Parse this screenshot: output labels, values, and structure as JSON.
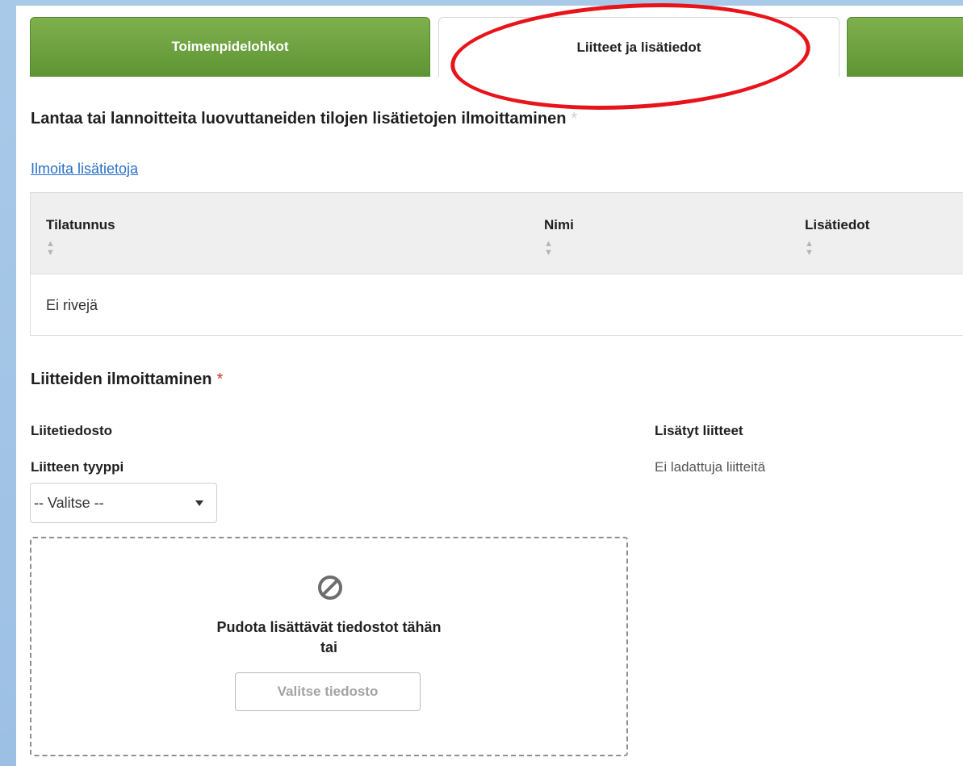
{
  "tabs": [
    {
      "label": "Toimenpidelohkot",
      "active": false
    },
    {
      "label": "Liitteet ja lisätiedot",
      "active": true
    },
    {
      "label": "",
      "active": false
    }
  ],
  "section1": {
    "title": "Lantaa tai lannoitteita luovuttaneiden tilojen lisätietojen ilmoittaminen",
    "required_mark": "*",
    "link": "Ilmoita lisätietoja"
  },
  "table": {
    "columns": [
      "Tilatunnus",
      "Nimi",
      "Lisätiedot"
    ],
    "sort_icon": "sort-icon",
    "empty_text": "Ei rivejä"
  },
  "section2": {
    "title": "Liitteiden ilmoittaminen",
    "required_mark": "*",
    "file_label": "Liitetiedosto",
    "type_label": "Liitteen tyyppi",
    "type_select_value": "-- Valitse --",
    "added_label": "Lisätyt liitteet",
    "no_attachments": "Ei ladattuja liitteitä",
    "drop_text_1": "Pudota lisättävät tiedostot tähän",
    "drop_text_2": "tai",
    "choose_button": "Valitse tiedosto"
  },
  "colors": {
    "tab_green": "#6aa33d",
    "link": "#2a6fc9",
    "required": "#c0392b",
    "highlight_ring": "#e8141b"
  }
}
